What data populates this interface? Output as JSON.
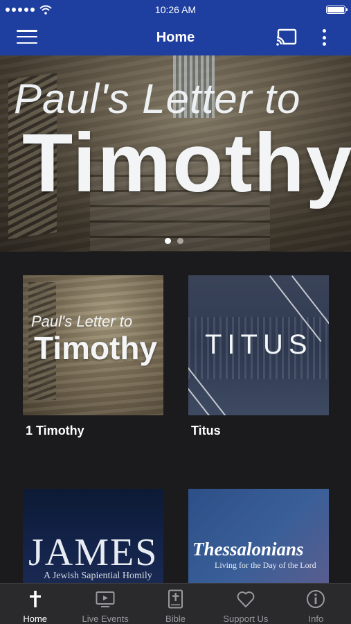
{
  "status_bar": {
    "time": "10:26 AM"
  },
  "nav": {
    "title": "Home"
  },
  "hero": {
    "subtitle": "Paul's Letter to",
    "title": "Timothy",
    "pages": 2,
    "current_page": 1
  },
  "series": [
    {
      "card_subtitle": "Paul's Letter to",
      "card_title": "Timothy",
      "label": "1 Timothy"
    },
    {
      "card_title": "TITUS",
      "label": "Titus"
    },
    {
      "card_title": "JAMES",
      "card_subtitle": "A Jewish Sapiential Homily"
    },
    {
      "card_title": "Thessalonians",
      "card_subtitle": "Living for the Day of the Lord"
    }
  ],
  "tabs": [
    {
      "label": "Home",
      "icon": "cross-icon",
      "active": true
    },
    {
      "label": "Live Events",
      "icon": "tv-icon",
      "active": false
    },
    {
      "label": "Bible",
      "icon": "bible-icon",
      "active": false
    },
    {
      "label": "Support Us",
      "icon": "heart-icon",
      "active": false
    },
    {
      "label": "Info",
      "icon": "info-icon",
      "active": false
    }
  ],
  "colors": {
    "header": "#1e3fa0",
    "background": "#1b1b1d",
    "tab_bar": "#2a2a2c",
    "tab_inactive": "#9a9a9e"
  }
}
